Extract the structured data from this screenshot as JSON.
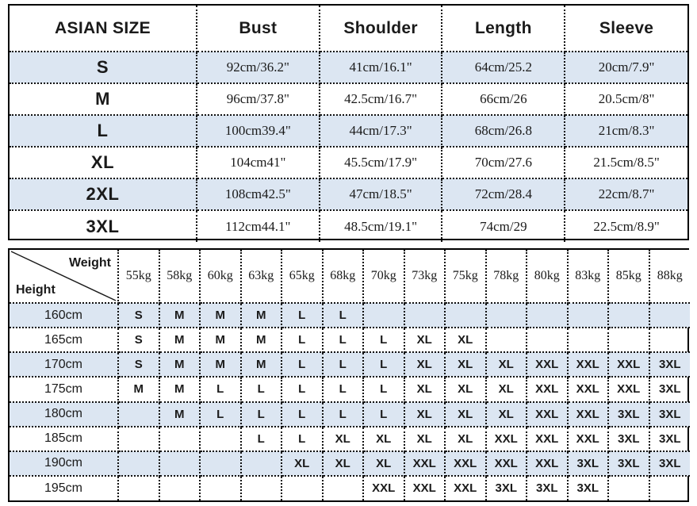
{
  "size_table": {
    "headers": [
      "ASIAN SIZE",
      "Bust",
      "Shoulder",
      "Length",
      "Sleeve"
    ],
    "rows": [
      {
        "size": "S",
        "bust": "92cm/36.2\"",
        "shoulder": "41cm/16.1\"",
        "length": "64cm/25.2",
        "sleeve": "20cm/7.9\""
      },
      {
        "size": "M",
        "bust": "96cm/37.8\"",
        "shoulder": "42.5cm/16.7\"",
        "length": "66cm/26",
        "sleeve": "20.5cm/8\""
      },
      {
        "size": "L",
        "bust": "100cm39.4\"",
        "shoulder": "44cm/17.3\"",
        "length": "68cm/26.8",
        "sleeve": "21cm/8.3\""
      },
      {
        "size": "XL",
        "bust": "104cm41\"",
        "shoulder": "45.5cm/17.9\"",
        "length": "70cm/27.6",
        "sleeve": "21.5cm/8.5\""
      },
      {
        "size": "2XL",
        "bust": "108cm42.5\"",
        "shoulder": "47cm/18.5\"",
        "length": "72cm/28.4",
        "sleeve": "22cm/8.7\""
      },
      {
        "size": "3XL",
        "bust": "112cm44.1\"",
        "shoulder": "48.5cm/19.1\"",
        "length": "74cm/29",
        "sleeve": "22.5cm/8.9\""
      }
    ]
  },
  "fit_table": {
    "corner": {
      "weight_label": "Weight",
      "height_label": "Height"
    },
    "weights": [
      "55kg",
      "58kg",
      "60kg",
      "63kg",
      "65kg",
      "68kg",
      "70kg",
      "73kg",
      "75kg",
      "78kg",
      "80kg",
      "83kg",
      "85kg",
      "88kg"
    ],
    "rows": [
      {
        "height": "160cm",
        "sizes": [
          "S",
          "M",
          "M",
          "M",
          "L",
          "L",
          "",
          "",
          "",
          "",
          "",
          "",
          "",
          ""
        ]
      },
      {
        "height": "165cm",
        "sizes": [
          "S",
          "M",
          "M",
          "M",
          "L",
          "L",
          "L",
          "XL",
          "XL",
          "",
          "",
          "",
          "",
          ""
        ]
      },
      {
        "height": "170cm",
        "sizes": [
          "S",
          "M",
          "M",
          "M",
          "L",
          "L",
          "L",
          "XL",
          "XL",
          "XL",
          "XXL",
          "XXL",
          "XXL",
          "3XL"
        ]
      },
      {
        "height": "175cm",
        "sizes": [
          "M",
          "M",
          "L",
          "L",
          "L",
          "L",
          "L",
          "XL",
          "XL",
          "XL",
          "XXL",
          "XXL",
          "XXL",
          "3XL"
        ]
      },
      {
        "height": "180cm",
        "sizes": [
          "",
          "M",
          "L",
          "L",
          "L",
          "L",
          "L",
          "XL",
          "XL",
          "XL",
          "XXL",
          "XXL",
          "3XL",
          "3XL"
        ]
      },
      {
        "height": "185cm",
        "sizes": [
          "",
          "",
          "",
          "L",
          "L",
          "XL",
          "XL",
          "XL",
          "XL",
          "XXL",
          "XXL",
          "XXL",
          "3XL",
          "3XL"
        ]
      },
      {
        "height": "190cm",
        "sizes": [
          "",
          "",
          "",
          "",
          "XL",
          "XL",
          "XL",
          "XXL",
          "XXL",
          "XXL",
          "XXL",
          "3XL",
          "3XL",
          "3XL"
        ]
      },
      {
        "height": "195cm",
        "sizes": [
          "",
          "",
          "",
          "",
          "",
          "",
          "XXL",
          "XXL",
          "XXL",
          "3XL",
          "3XL",
          "3XL",
          "",
          ""
        ]
      }
    ]
  },
  "colors": {
    "shaded_row": "#dce6f2",
    "border": "#000000",
    "text": "#1a1a1a"
  }
}
